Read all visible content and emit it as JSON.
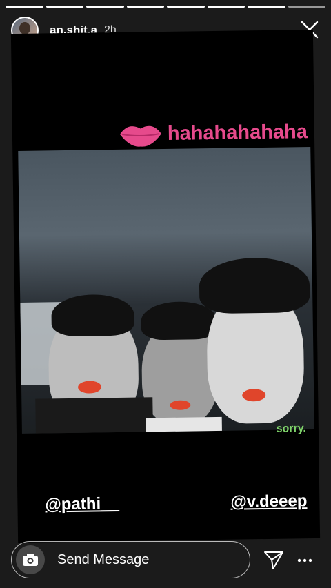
{
  "story": {
    "segments_total": 8,
    "segments_done": 7,
    "username": "an.shit.a",
    "posted": "2h",
    "sticker_text": "hahahahahaha",
    "caption": "sorry.",
    "mention_left": "@pathi__",
    "mention_right": "@v.deeep"
  },
  "footer": {
    "message_placeholder": "Send Message"
  },
  "icons": {
    "close": "close-icon",
    "camera": "camera-icon",
    "send": "send-icon",
    "more": "more-icon"
  },
  "colors": {
    "sticker_pink": "#e64a8c",
    "caption_green": "#7fd36a",
    "lip_red": "#e0452b"
  }
}
